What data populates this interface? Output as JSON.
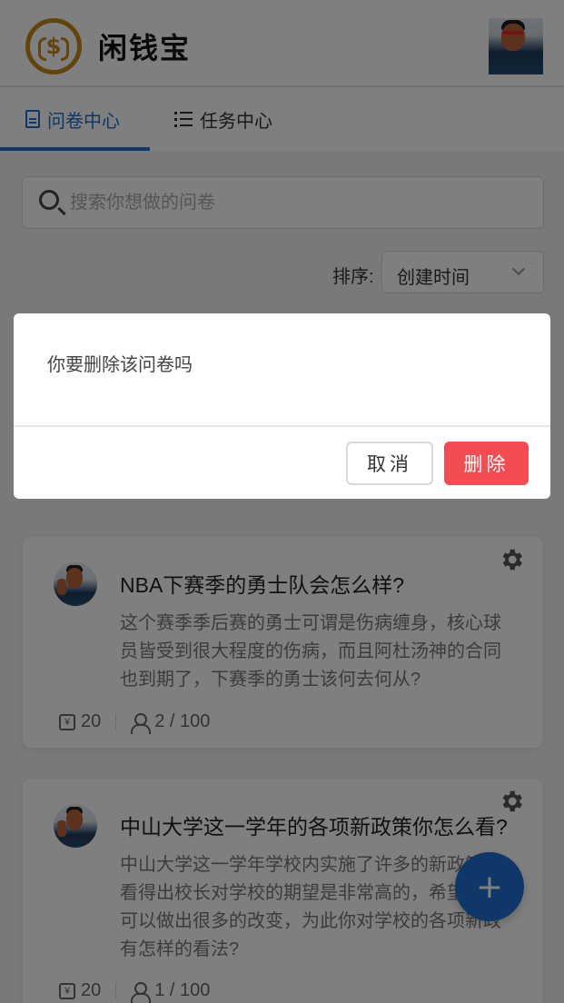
{
  "header": {
    "logo_text": "$",
    "app_title": "闲钱宝"
  },
  "tabs": [
    {
      "label": "问卷中心",
      "icon": "document-icon",
      "active": true
    },
    {
      "label": "任务中心",
      "icon": "list-icon",
      "active": false
    }
  ],
  "search": {
    "placeholder": "搜索你想做的问卷",
    "value": ""
  },
  "sort": {
    "label": "排序:",
    "selected": "创建时间"
  },
  "cards": [
    {
      "title": "NBA下赛季的勇士队会怎么样?",
      "description": "这个赛季季后赛的勇士可谓是伤病缠身，核心球员皆受到很大程度的伤病，而且阿杜汤神的合同也到期了，下赛季的勇士该何去何从?",
      "reward": "20",
      "participants": "2 / 100"
    },
    {
      "title": "中山大学这一学年的各项新政策你怎么看?",
      "description": "中山大学这一学年学校内实施了许多的新政策，看得出校长对学校的期望是非常高的，希望学校可以做出很多的改变，为此你对学校的各项新政有怎样的看法?",
      "reward": "20",
      "participants": "1 / 100"
    }
  ],
  "fab": {
    "label": "+"
  },
  "dialog": {
    "message": "你要删除该问卷吗",
    "cancel_label": "取消",
    "delete_label": "删除"
  },
  "colors": {
    "accent": "#1f6fcf",
    "danger": "#f24d53",
    "logo_gold": "#c38b18"
  }
}
